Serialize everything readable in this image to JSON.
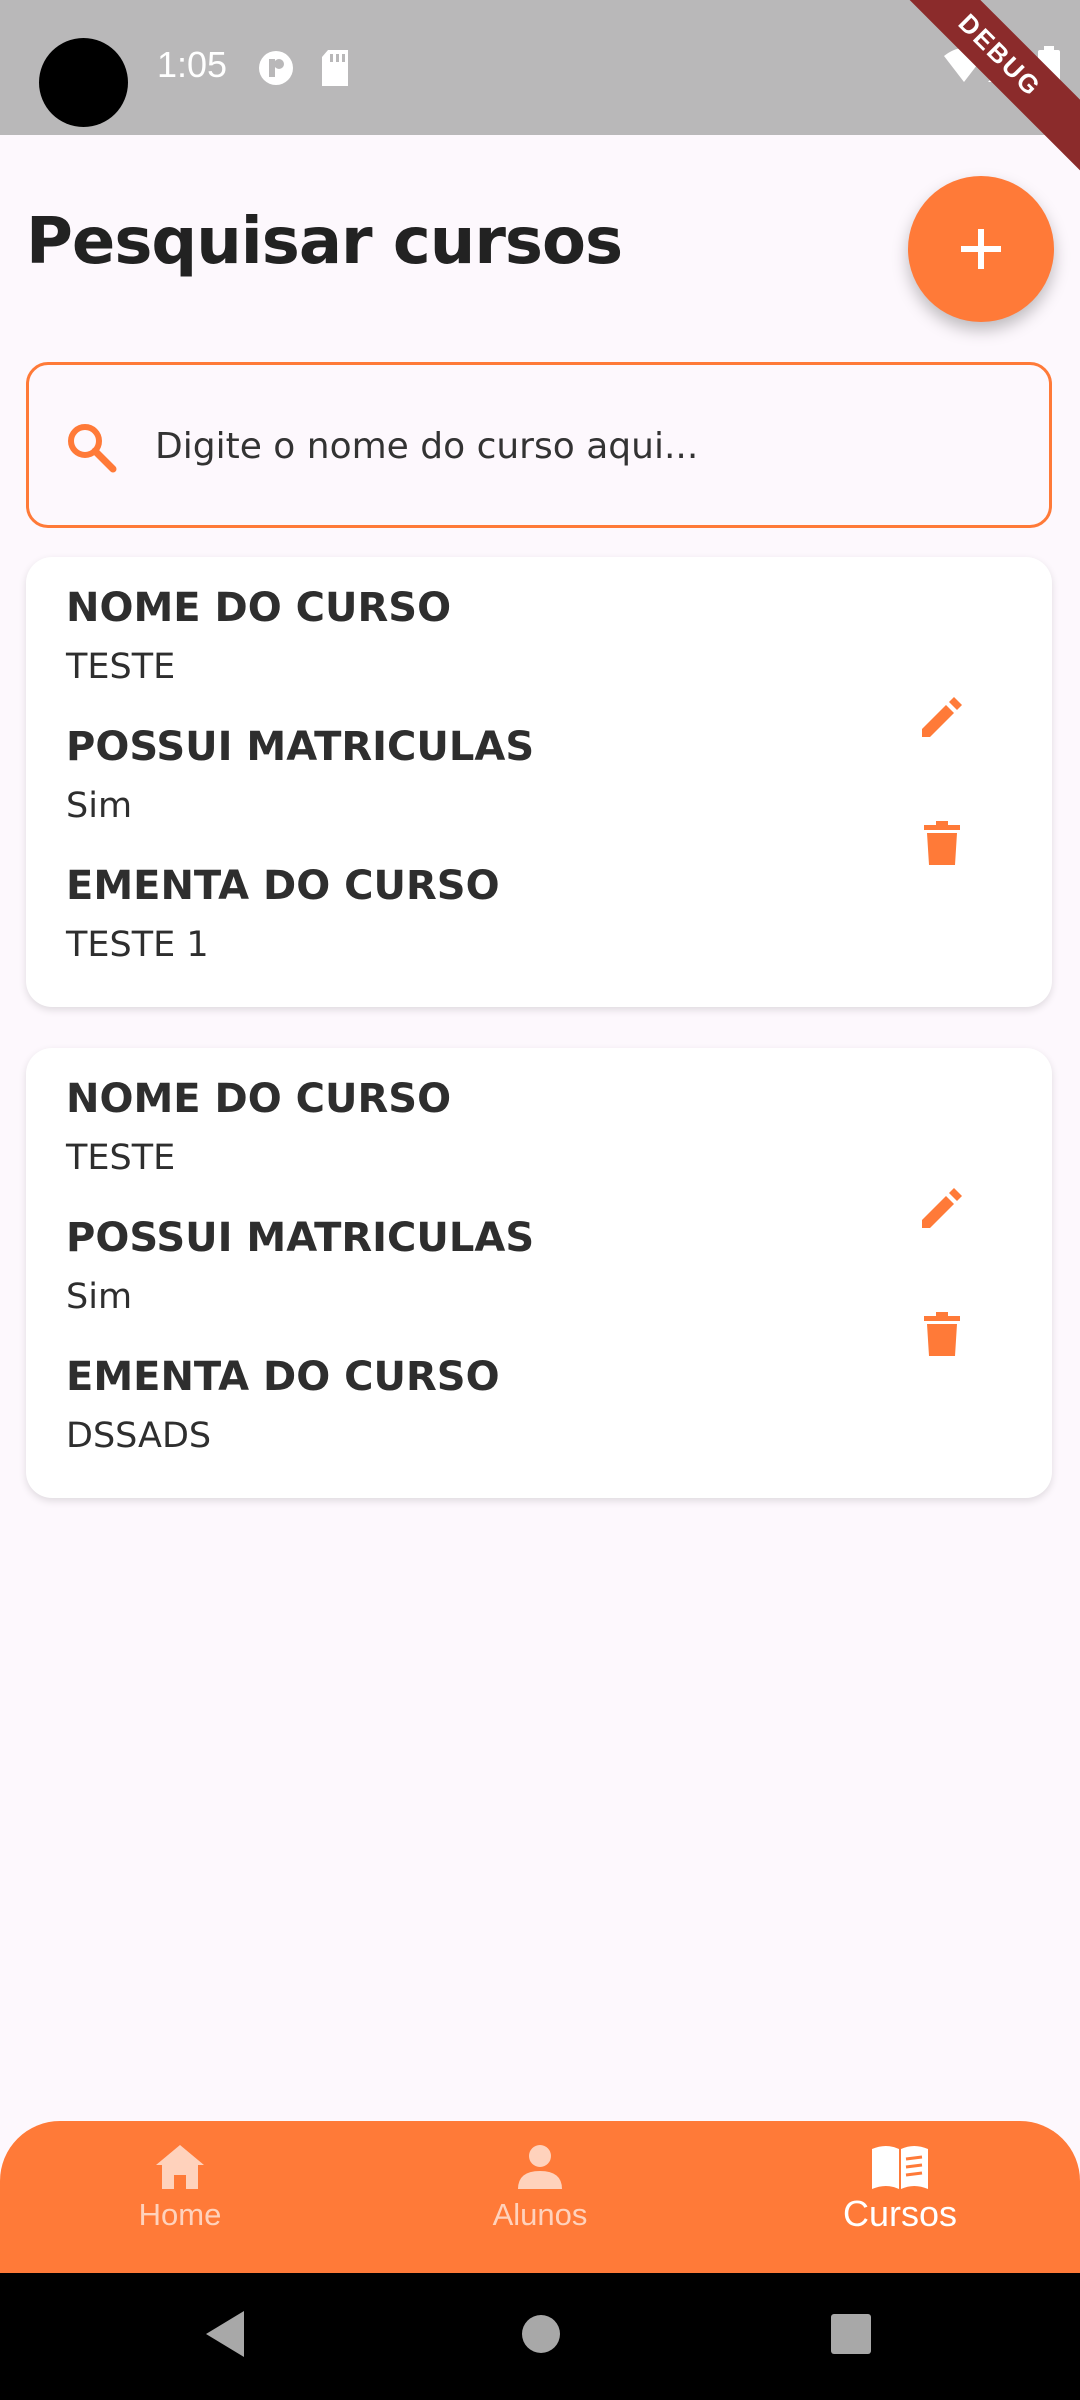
{
  "status_bar": {
    "time": "1:05",
    "debug_banner": "DEBUG"
  },
  "header": {
    "title": "Pesquisar cursos",
    "add_button_icon": "plus-icon"
  },
  "search": {
    "placeholder": "Digite o nome do curso aqui...",
    "value": ""
  },
  "courses": [
    {
      "name_label": "NOME DO CURSO",
      "name": "TESTE",
      "enrollment_label": "POSSUI MATRICULAS",
      "has_enrollments": "Sim",
      "syllabus_label": "EMENTA DO CURSO",
      "syllabus": "TESTE 1"
    },
    {
      "name_label": "NOME DO CURSO",
      "name": "TESTE",
      "enrollment_label": "POSSUI MATRICULAS",
      "has_enrollments": "Sim",
      "syllabus_label": "EMENTA DO CURSO",
      "syllabus": "DSSADS"
    }
  ],
  "bottom_nav": {
    "items": [
      {
        "label": "Home",
        "icon": "home-icon",
        "active": false
      },
      {
        "label": "Alunos",
        "icon": "person-icon",
        "active": false
      },
      {
        "label": "Cursos",
        "icon": "book-icon",
        "active": true
      }
    ]
  },
  "colors": {
    "accent": "#ff7a38",
    "background": "#fdf8fd",
    "status_bar": "#b9b8b9"
  }
}
